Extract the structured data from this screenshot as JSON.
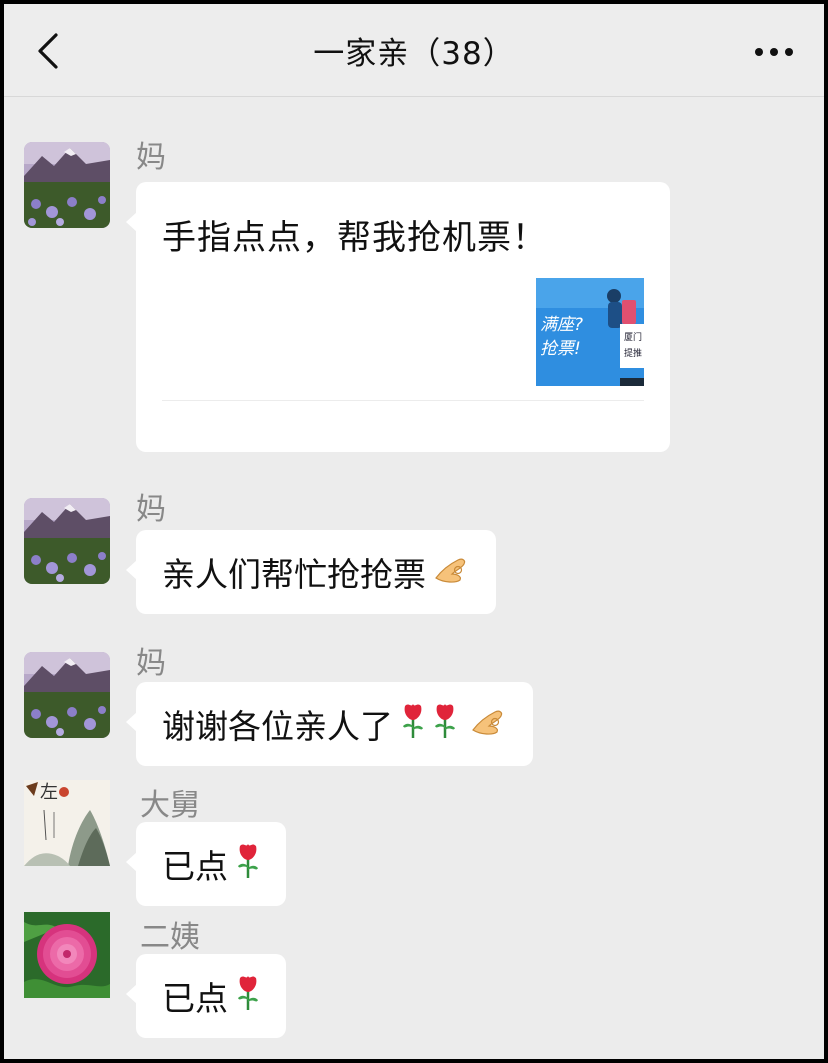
{
  "header": {
    "title": "一家亲（38）"
  },
  "messages": [
    {
      "sender": "妈",
      "type": "card",
      "card_title": "手指点点，帮我抢机票！",
      "thumb_text_1": "满座?",
      "thumb_text_2": "抢票!",
      "thumb_text_3": "厦门",
      "thumb_text_4": "提推"
    },
    {
      "sender": "妈",
      "text": "亲人们帮忙抢抢票",
      "emoji": [
        "ok-hand"
      ]
    },
    {
      "sender": "妈",
      "text": "谢谢各位亲人了",
      "emoji": [
        "rose",
        "rose",
        "ok-hand"
      ]
    },
    {
      "sender": "大舅",
      "text": "已点",
      "emoji": [
        "rose"
      ],
      "avatar_text": "左"
    },
    {
      "sender": "二姨",
      "text": "已点",
      "emoji": [
        "rose"
      ]
    }
  ],
  "colors": {
    "background": "#ececec",
    "bubble": "#ffffff",
    "sender_name": "#888888"
  }
}
